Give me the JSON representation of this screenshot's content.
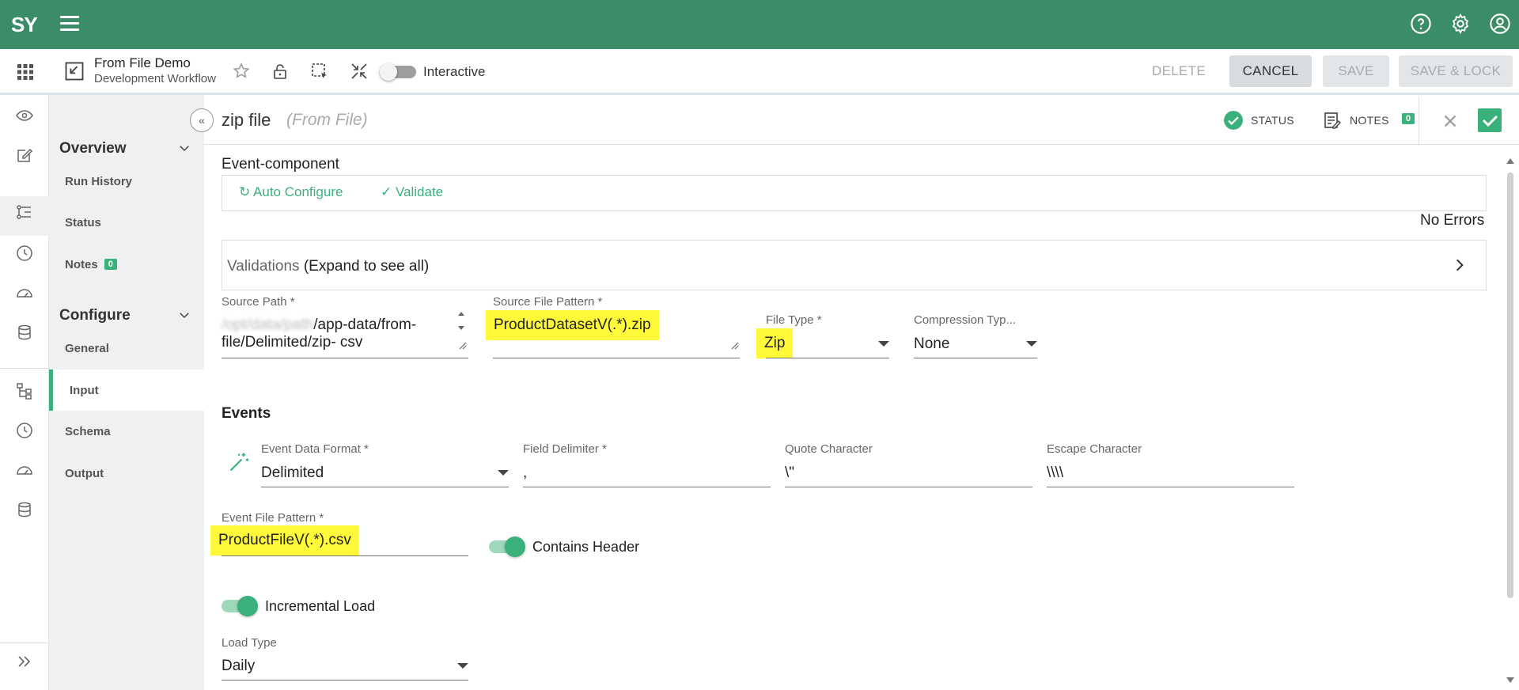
{
  "app": {
    "logo": "SY"
  },
  "header": {
    "title": "From File Demo",
    "subtitle": "Development Workflow",
    "interactive_label": "Interactive",
    "buttons": {
      "delete": "DELETE",
      "cancel": "CANCEL",
      "save": "SAVE",
      "save_lock": "SAVE & LOCK"
    }
  },
  "nav": {
    "overview": {
      "label": "Overview",
      "items": [
        {
          "label": "Run History"
        },
        {
          "label": "Status"
        },
        {
          "label": "Notes",
          "badge": "0"
        }
      ]
    },
    "configure": {
      "label": "Configure",
      "items": [
        {
          "label": "General"
        },
        {
          "label": "Input"
        },
        {
          "label": "Schema"
        },
        {
          "label": "Output"
        }
      ]
    }
  },
  "component": {
    "title": "zip file",
    "type": "(From File)",
    "status_label": "STATUS",
    "notes_label": "NOTES",
    "notes_count": "0"
  },
  "form": {
    "section": "Event-component",
    "auto_configure": "Auto Configure",
    "validate": "Validate",
    "no_errors": "No Errors",
    "validations_label": "Validations",
    "validations_hint": "(Expand to see all)",
    "source_path": {
      "label": "Source Path *",
      "value_line1": "/app-data/from-",
      "value_line2": "file/Delimited/zip- csv"
    },
    "source_file_pattern": {
      "label": "Source File Pattern *",
      "value": "ProductDatasetV(.*).zip"
    },
    "file_type": {
      "label": "File Type *",
      "value": "Zip"
    },
    "compression_type": {
      "label": "Compression Typ...",
      "value": "None"
    },
    "events_title": "Events",
    "event_data_format": {
      "label": "Event Data Format *",
      "value": "Delimited"
    },
    "field_delimiter": {
      "label": "Field Delimiter *",
      "value": ","
    },
    "quote_character": {
      "label": "Quote Character",
      "value": "\\\""
    },
    "escape_character": {
      "label": "Escape Character",
      "value": "\\\\\\\\"
    },
    "event_file_pattern": {
      "label": "Event File Pattern *",
      "value": "ProductFileV(.*).csv"
    },
    "contains_header": {
      "label": "Contains Header",
      "on": true
    },
    "incremental_load": {
      "label": "Incremental Load",
      "on": true
    },
    "load_type": {
      "label": "Load Type",
      "value": "Daily"
    }
  },
  "colors": {
    "brand": "#3a8d66",
    "accent": "#3ab07b",
    "highlight": "#fff93a"
  }
}
